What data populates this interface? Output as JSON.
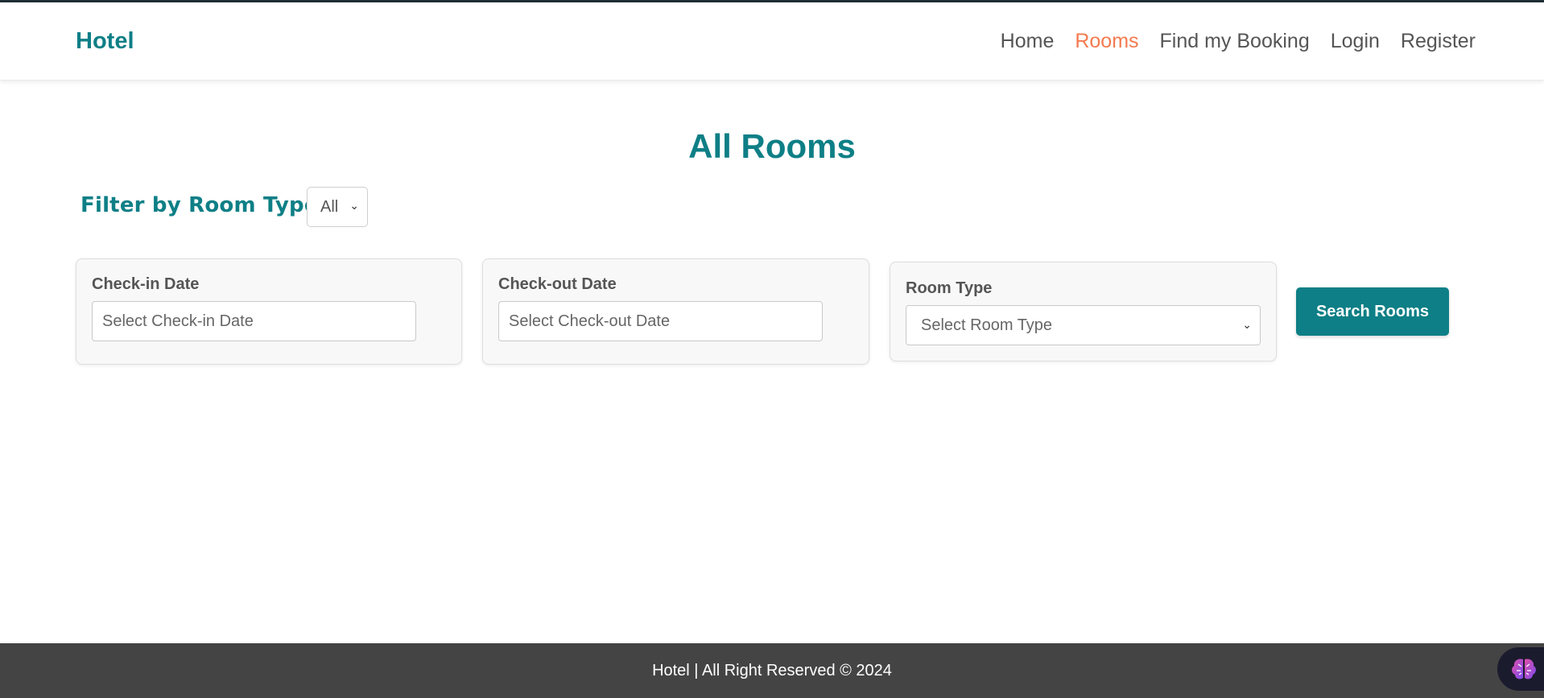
{
  "nav": {
    "brand": "Hotel",
    "links": [
      "Home",
      "Rooms",
      "Find my Booking",
      "Login",
      "Register"
    ],
    "active": "Rooms"
  },
  "page": {
    "title": "All Rooms",
    "filter_label": "Filter by Room Type:",
    "filter_value": "All"
  },
  "search": {
    "checkin_label": "Check-in Date",
    "checkin_placeholder": "Select Check-in Date",
    "checkout_label": "Check-out Date",
    "checkout_placeholder": "Select Check-out Date",
    "roomtype_label": "Room Type",
    "roomtype_value": "Select Room Type",
    "button": "Search Rooms"
  },
  "footer": {
    "text": "Hotel | All Right Reserved © 2024"
  },
  "icons": {
    "chevron": "chevron-down-icon",
    "extension": "brain-icon"
  },
  "colors": {
    "brand": "#0e7f86",
    "active_link": "#f47a4f",
    "footer_bg": "#444444"
  }
}
